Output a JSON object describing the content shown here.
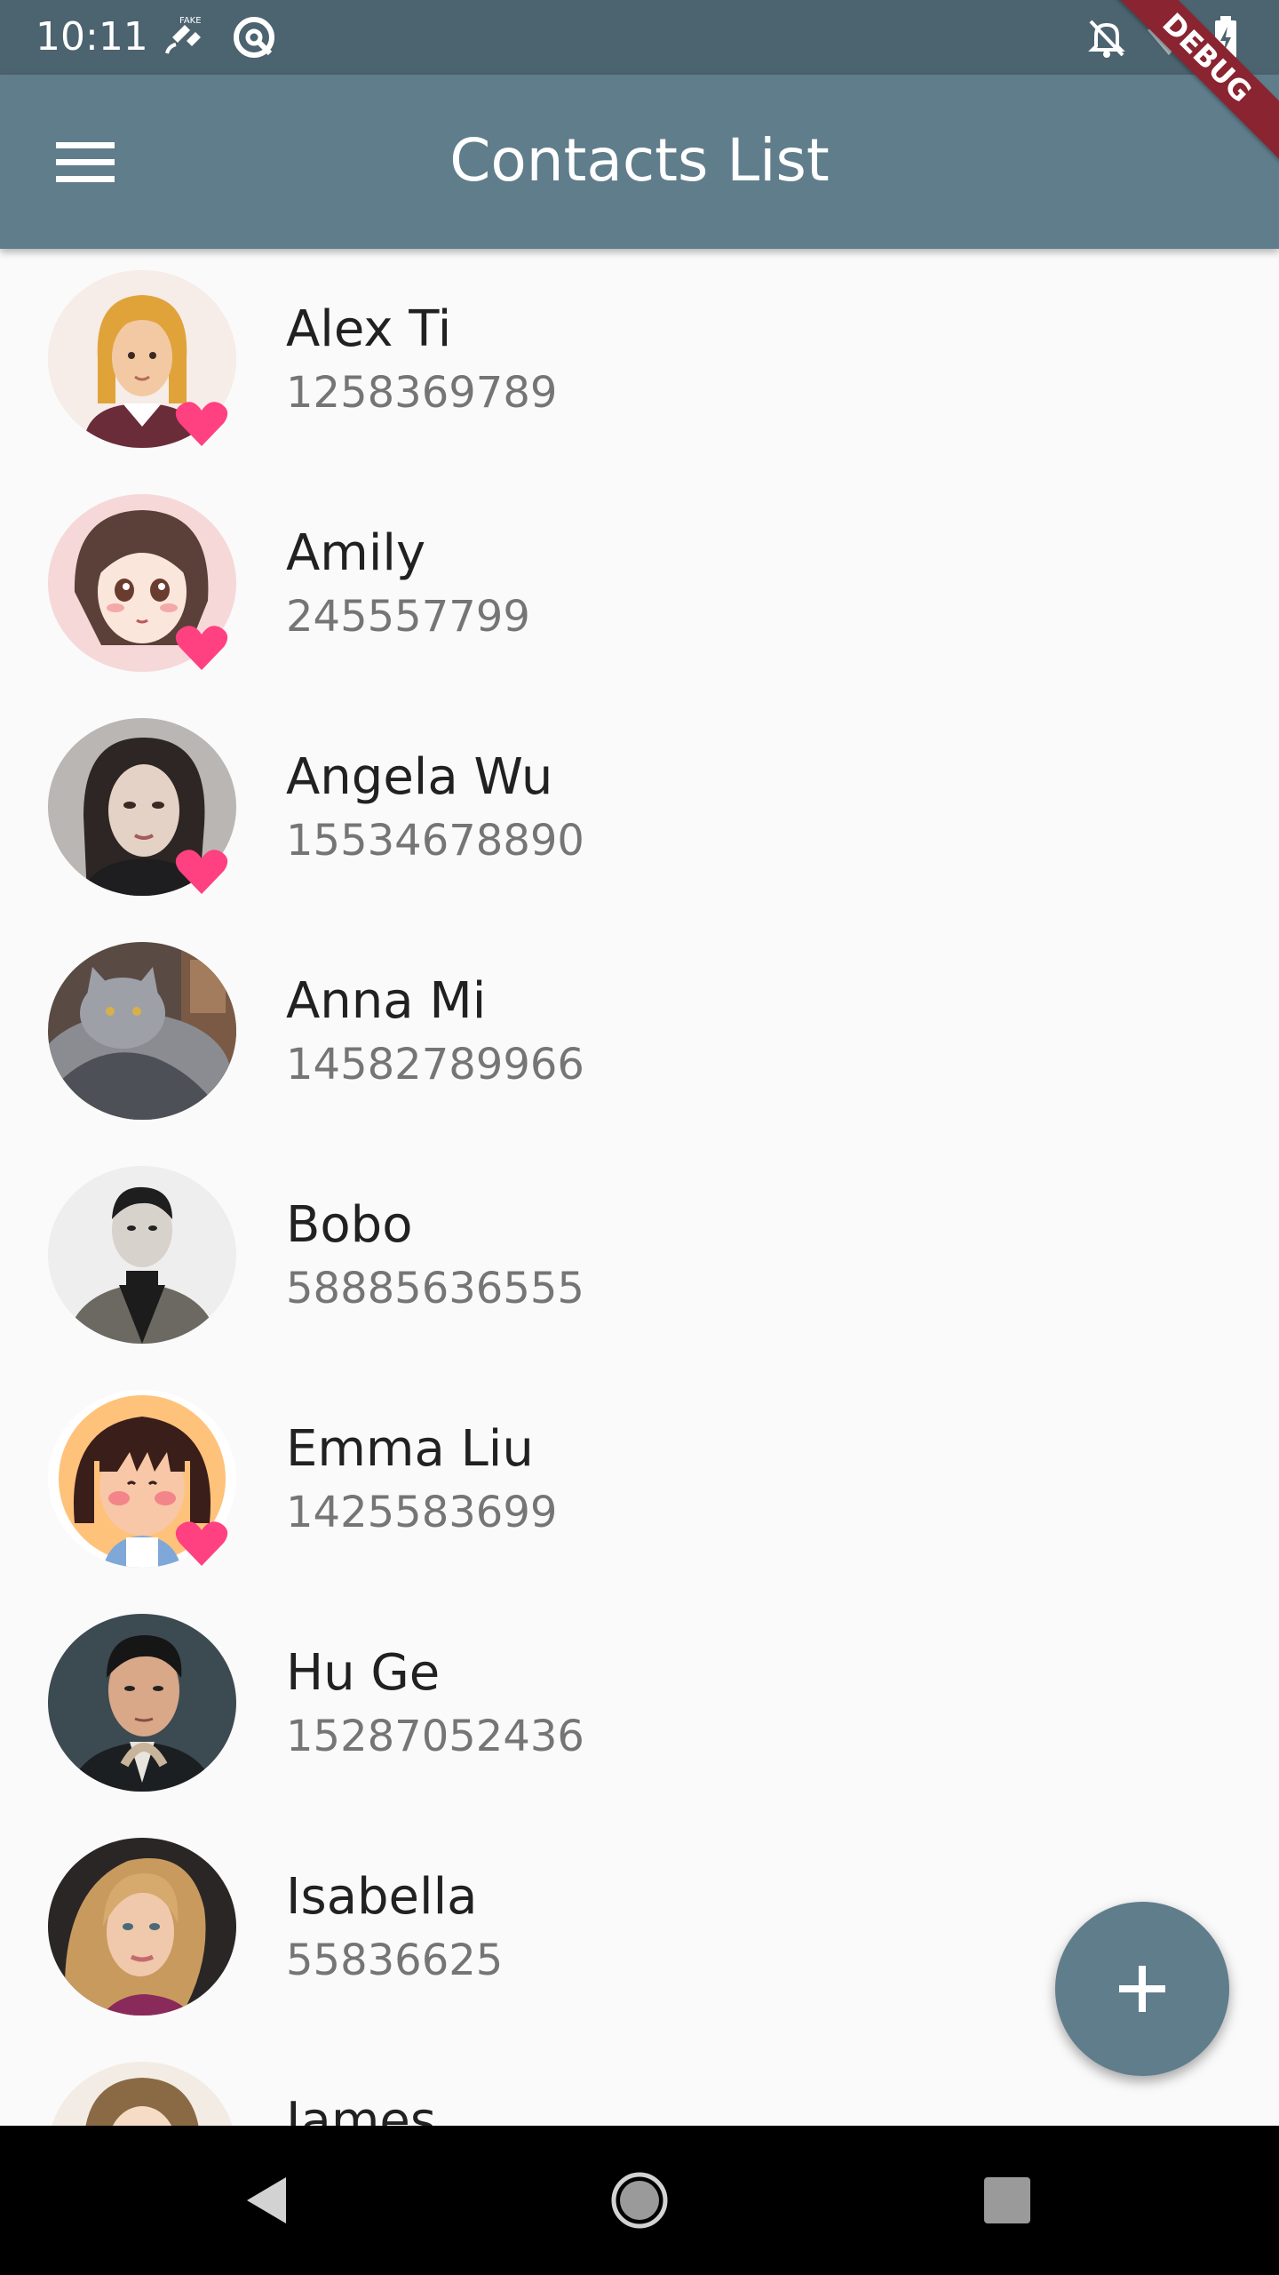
{
  "status_bar": {
    "time": "10:11",
    "icons": [
      "fake-gps-icon",
      "sync-icon",
      "notifications-off-icon",
      "wifi-icon",
      "battery-charging-icon"
    ]
  },
  "debug_banner": "DEBUG",
  "app_bar": {
    "title": "Contacts List",
    "menu_icon": "menu-icon"
  },
  "contacts": [
    {
      "name": "Alex Ti",
      "phone": "1258369789",
      "favorite": true
    },
    {
      "name": "Amily",
      "phone": "245557799",
      "favorite": true
    },
    {
      "name": "Angela Wu",
      "phone": "15534678890",
      "favorite": true
    },
    {
      "name": "Anna Mi",
      "phone": "14582789966",
      "favorite": false
    },
    {
      "name": "Bobo",
      "phone": "58885636555",
      "favorite": false
    },
    {
      "name": "Emma Liu",
      "phone": "1425583699",
      "favorite": true
    },
    {
      "name": "Hu Ge",
      "phone": "15287052436",
      "favorite": false
    },
    {
      "name": "Isabella",
      "phone": "55836625",
      "favorite": false
    },
    {
      "name": "James",
      "phone": "",
      "favorite": false
    }
  ],
  "fab": {
    "icon": "add-icon"
  },
  "nav_bar": {
    "icons": [
      "back-icon",
      "home-icon",
      "recents-icon"
    ]
  },
  "colors": {
    "app_bar": "#607d8b",
    "status_bar": "#4c6370",
    "favorite": "#ff4081",
    "debug_banner": "#8a2430"
  }
}
